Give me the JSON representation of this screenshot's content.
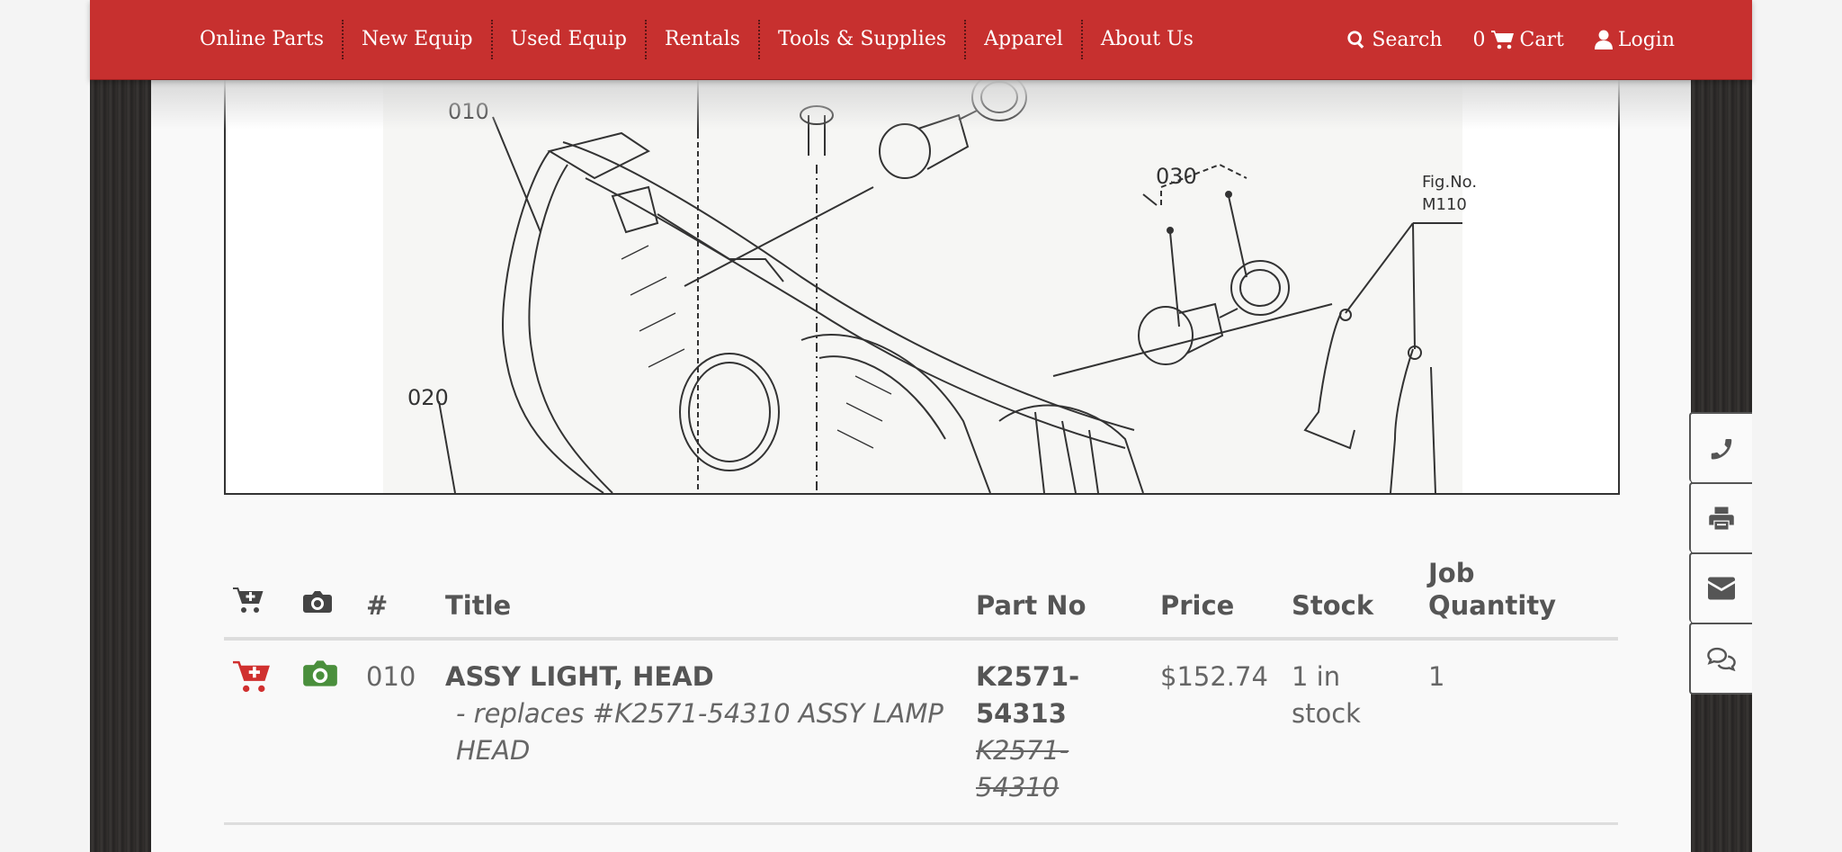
{
  "nav": {
    "items": [
      {
        "label": "Online Parts"
      },
      {
        "label": "New Equip"
      },
      {
        "label": "Used Equip"
      },
      {
        "label": "Rentals"
      },
      {
        "label": "Tools & Supplies"
      },
      {
        "label": "Apparel"
      },
      {
        "label": "About Us"
      }
    ],
    "search_label": "Search",
    "cart_count": "0",
    "cart_label": "Cart",
    "login_label": "Login"
  },
  "diagram": {
    "callouts": [
      "010",
      "020",
      "030"
    ],
    "fig_label_line1": "Fig.No.",
    "fig_label_line2": "M110"
  },
  "table": {
    "headers": {
      "number": "#",
      "title": "Title",
      "part_no": "Part No",
      "price": "Price",
      "stock": "Stock",
      "job_qty_line1": "Job",
      "job_qty_line2": "Quantity"
    },
    "rows": [
      {
        "number": "010",
        "title": "ASSY LIGHT, HEAD",
        "subtitle": "- replaces #K2571-54310 ASSY LAMP HEAD",
        "part_no_line1": "K2571-",
        "part_no_line2": "54313",
        "old_part_line1": "K2571-",
        "old_part_line2": "54310",
        "price": "$152.74",
        "stock_line1": "1 in",
        "stock_line2": "stock",
        "job_qty": "1"
      }
    ]
  },
  "icons": {
    "add_to_cart": "cart-plus-icon",
    "photo": "camera-icon",
    "side_tools": [
      "phone-icon",
      "print-icon",
      "envelope-icon",
      "chat-icon"
    ]
  },
  "colors": {
    "nav_red": "#c7302f",
    "cart_red": "#d0302f",
    "camera_green": "#4a8f3c",
    "header_icon": "#444444"
  }
}
